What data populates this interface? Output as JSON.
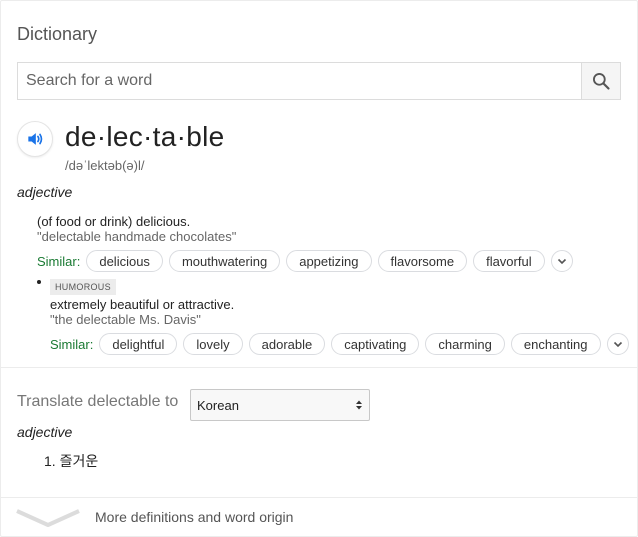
{
  "card": {
    "title": "Dictionary",
    "search": {
      "placeholder": "Search for a word",
      "value": ""
    },
    "entry": {
      "word": "de·lec·ta·ble",
      "phonetic": "/dəˈlektəb(ə)l/",
      "part_of_speech": "adjective",
      "senses": [
        {
          "definition": "(of food or drink) delicious.",
          "example": "\"delectable handmade chocolates\"",
          "similar_label": "Similar:",
          "similar": [
            "delicious",
            "mouthwatering",
            "appetizing",
            "flavorsome",
            "flavorful"
          ]
        },
        {
          "tag": "HUMOROUS",
          "definition": "extremely beautiful or attractive.",
          "example": "\"the delectable Ms. Davis\"",
          "similar_label": "Similar:",
          "similar": [
            "delightful",
            "lovely",
            "adorable",
            "captivating",
            "charming",
            "enchanting"
          ]
        }
      ]
    },
    "translate": {
      "label": "Translate delectable to",
      "language": "Korean",
      "part_of_speech": "adjective",
      "results": [
        "1. 즐거운"
      ]
    },
    "more_label": "More definitions and word origin"
  },
  "icons": {
    "search": "search-icon",
    "speaker": "speaker-icon",
    "expand": "chevron-down-icon",
    "select": "select-arrows-icon",
    "more": "chevron-down-icon"
  },
  "colors": {
    "similar_label": "#1a7a33",
    "speaker": "#1a73e8",
    "divider": "#ececec"
  }
}
